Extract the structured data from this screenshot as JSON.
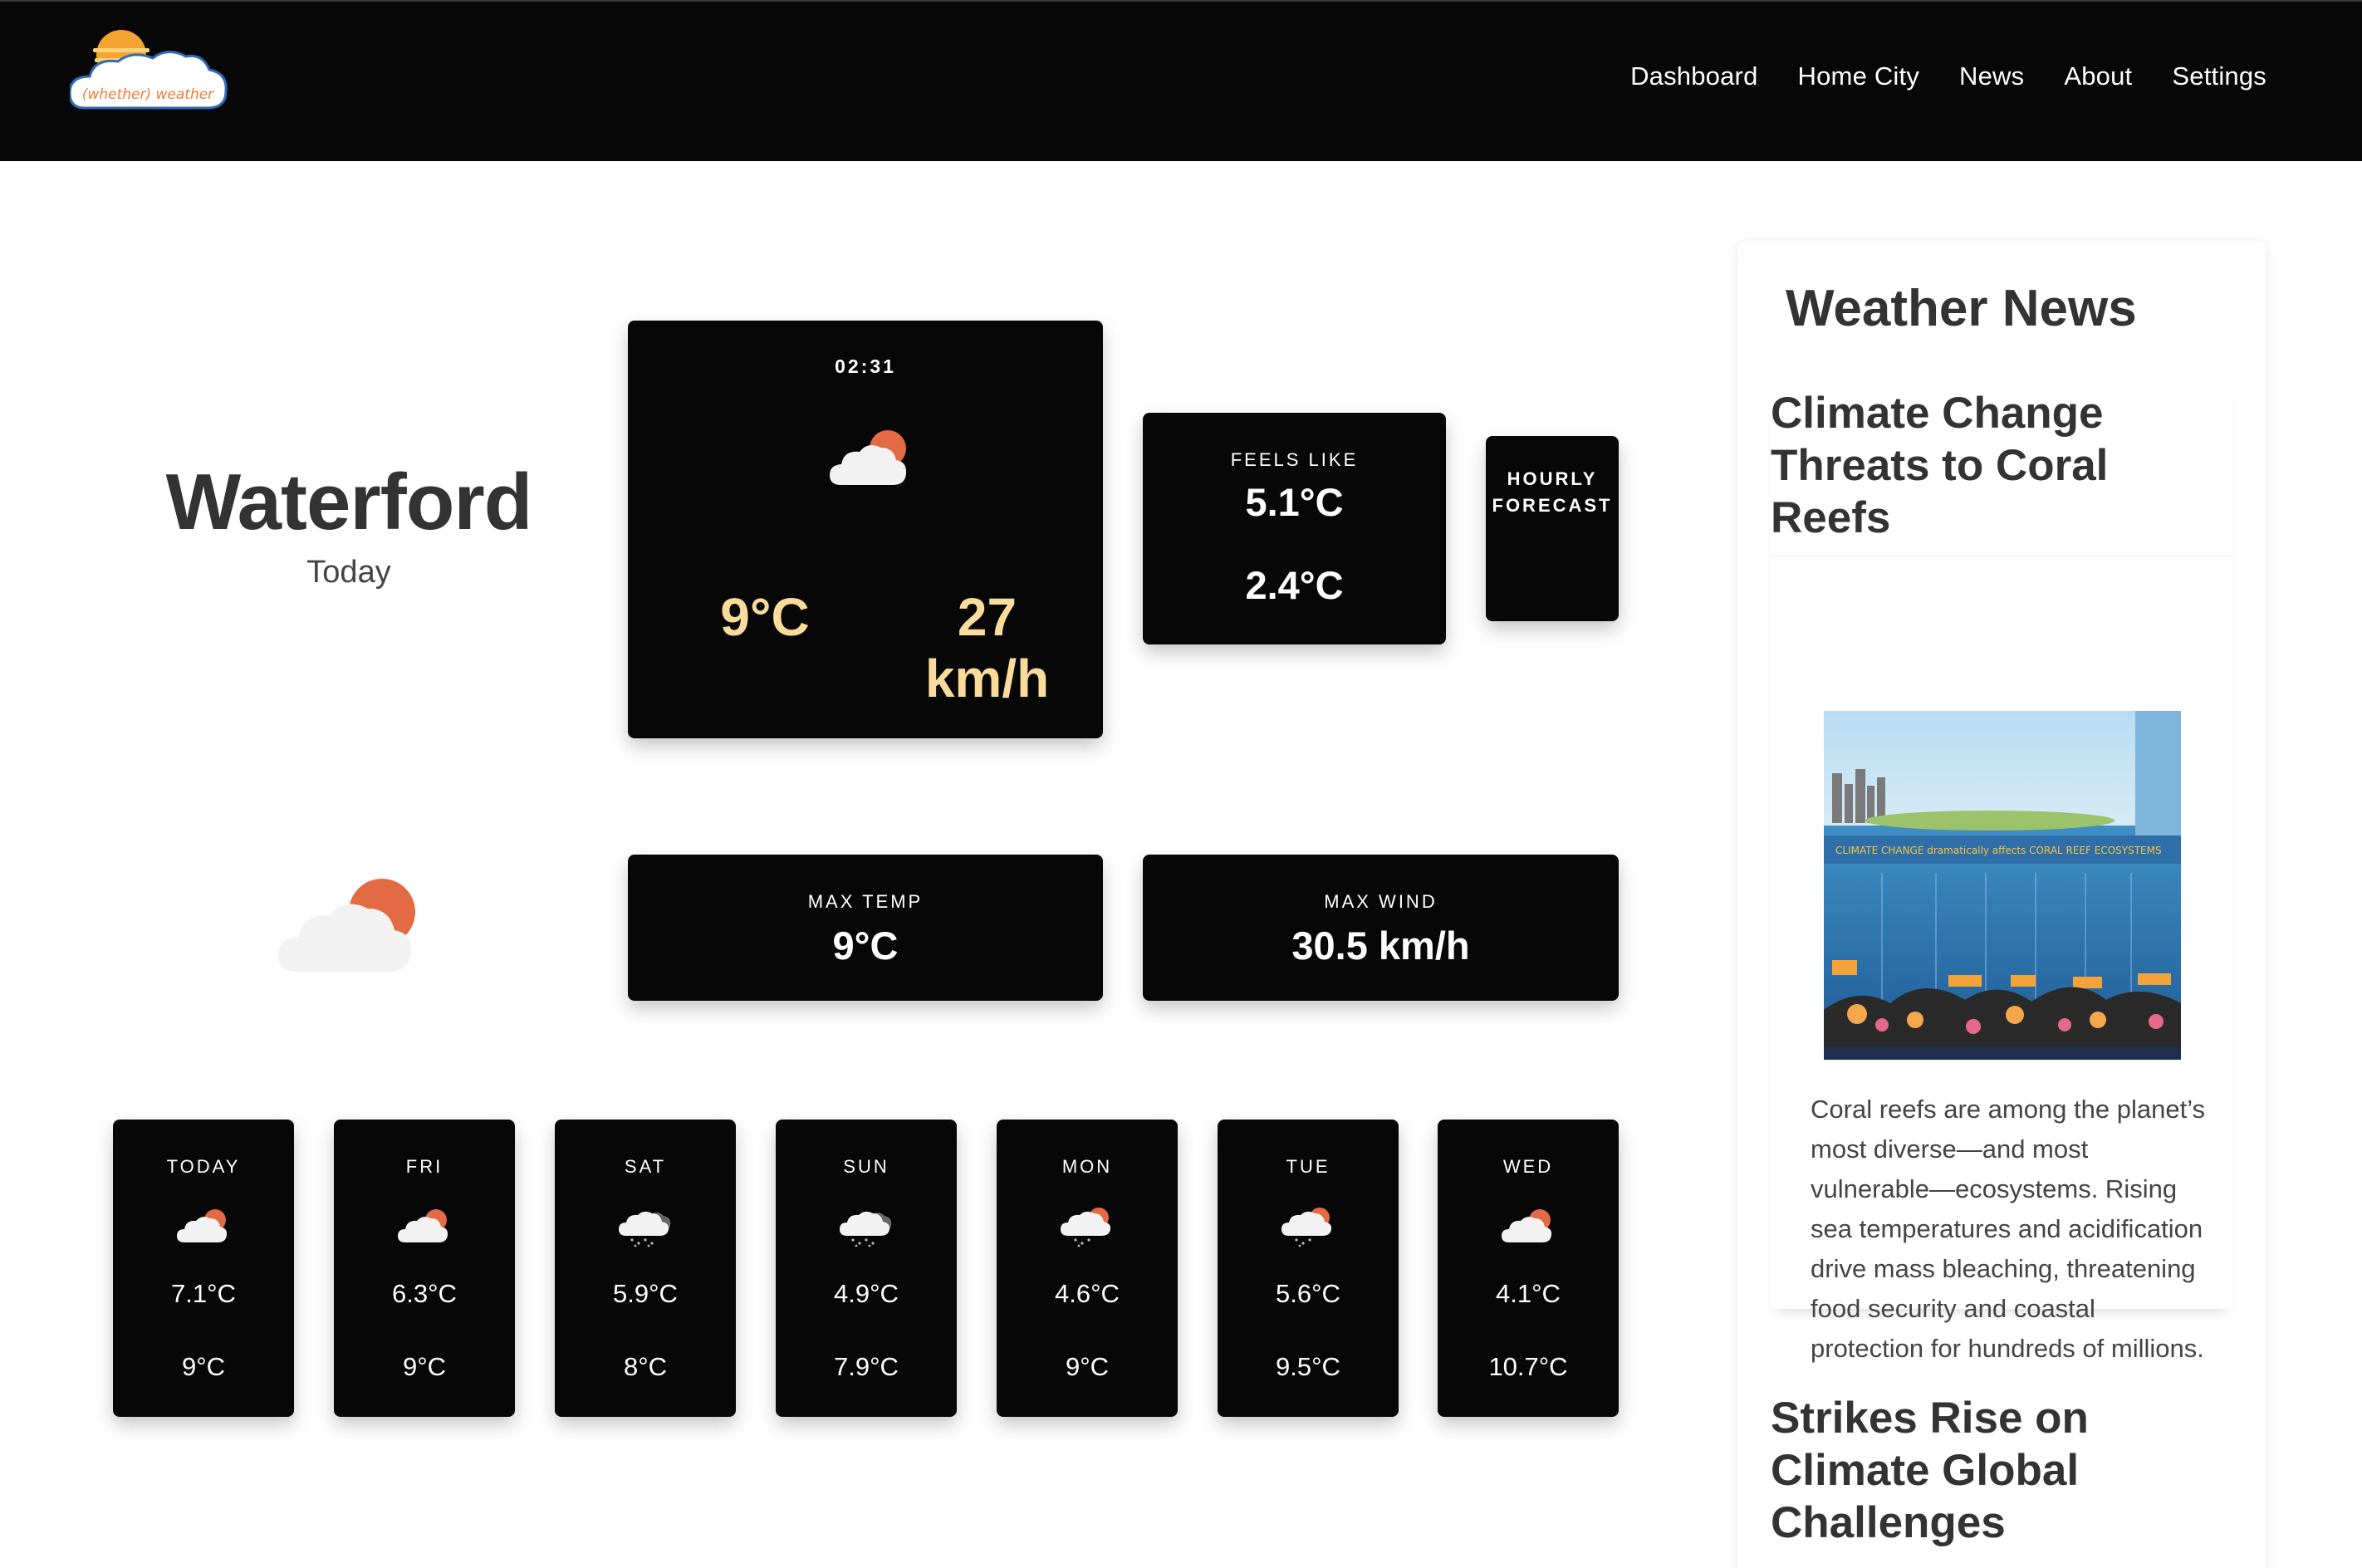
{
  "nav": {
    "logo_text": "(whether) weather",
    "links": [
      "Dashboard",
      "Home City",
      "News",
      "About",
      "Settings"
    ]
  },
  "city": {
    "name": "Waterford",
    "day": "Today"
  },
  "current": {
    "time": "02:31",
    "temp": "9°C",
    "wind": "27 km/h",
    "icon": "partly-cloudy-icon"
  },
  "feels": {
    "label": "FEELS LIKE",
    "value1": "5.1°C",
    "value2": "2.4°C"
  },
  "hourly": {
    "label": "HOURLY FORECAST"
  },
  "max_temp": {
    "label": "MAX TEMP",
    "value": "9°C"
  },
  "max_wind": {
    "label": "MAX WIND",
    "value": "30.5 km/h"
  },
  "forecast": [
    {
      "day": "TODAY",
      "low": "7.1°C",
      "high": "9°C",
      "icon": "partly-cloudy-icon"
    },
    {
      "day": "FRI",
      "low": "6.3°C",
      "high": "9°C",
      "icon": "partly-cloudy-icon"
    },
    {
      "day": "SAT",
      "low": "5.9°C",
      "high": "8°C",
      "icon": "rain-cloud-icon"
    },
    {
      "day": "SUN",
      "low": "4.9°C",
      "high": "7.9°C",
      "icon": "rain-cloud-icon"
    },
    {
      "day": "MON",
      "low": "4.6°C",
      "high": "9°C",
      "icon": "partly-cloudy-drizzle-icon"
    },
    {
      "day": "TUE",
      "low": "5.6°C",
      "high": "9.5°C",
      "icon": "partly-cloudy-drizzle-icon"
    },
    {
      "day": "WED",
      "low": "4.1°C",
      "high": "10.7°C",
      "icon": "partly-cloudy-icon"
    }
  ],
  "news": {
    "title": "Weather News",
    "articles": [
      {
        "headline": "Climate Change Threats to Coral Reefs",
        "body": "Coral reefs are among the planet’s most diverse—and most vulnerable—ecosystems. Rising sea temperatures and acidification drive mass bleaching, threatening food security and coastal protection for hundreds of millions.",
        "image_caption": "CLIMATE CHANGE dramatically affects CORAL REEF ECOSYSTEMS"
      },
      {
        "headline": "Strikes Rise on Climate Global Challenges"
      }
    ]
  },
  "colors": {
    "navbar_bg": "#070707",
    "card_bg": "#070707",
    "accent_temp": "#f9dc9c",
    "sun_orange": "#e26a45",
    "cloud": "#f2f2f2"
  }
}
